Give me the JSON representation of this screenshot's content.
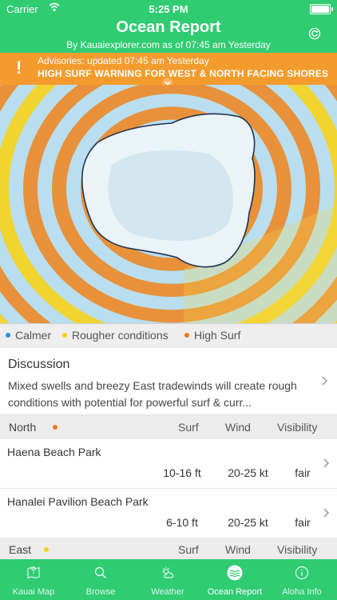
{
  "status": {
    "carrier": "Carrier",
    "time": "5:25 PM"
  },
  "header": {
    "title": "Ocean Report",
    "subtitle": "By Kauaiexplorer.com as of 07:45 am Yesterday"
  },
  "advisory": {
    "updated": "Advisories: updated 07:45 am Yesterday",
    "warning": "HIGH SURF WARNING FOR WEST & NORTH FACING SHORES"
  },
  "legend": [
    {
      "label": "Calmer",
      "color": "#2e8fd6"
    },
    {
      "label": "Rougher conditions",
      "color": "#f4d313"
    },
    {
      "label": "High Surf",
      "color": "#ee7b1c"
    }
  ],
  "discussion": {
    "label": "Discussion",
    "text": "Mixed swells and breezy East tradewinds will create rough conditions with potential for powerful surf & curr..."
  },
  "columns": {
    "surf": "Surf",
    "wind": "Wind",
    "visibility": "Visibility"
  },
  "regions": [
    {
      "name": "North",
      "dot_color": "#ee7b1c",
      "beaches": [
        {
          "name": "Haena Beach Park",
          "surf": "10-16 ft",
          "wind": "20-25 kt",
          "visibility": "fair"
        },
        {
          "name": "Hanalei Pavilion Beach Park",
          "surf": "6-10 ft",
          "wind": "20-25 kt",
          "visibility": "fair"
        }
      ]
    },
    {
      "name": "East",
      "dot_color": "#f4d313",
      "beaches": []
    }
  ],
  "tabs": [
    {
      "label": "Kauai Map",
      "icon": "map-icon",
      "active": false
    },
    {
      "label": "Browse",
      "icon": "search-icon",
      "active": false
    },
    {
      "label": "Weather",
      "icon": "weather-icon",
      "active": false
    },
    {
      "label": "Ocean Report",
      "icon": "waves-icon",
      "active": true
    },
    {
      "label": "Aloha Info",
      "icon": "info-icon",
      "active": false
    }
  ]
}
